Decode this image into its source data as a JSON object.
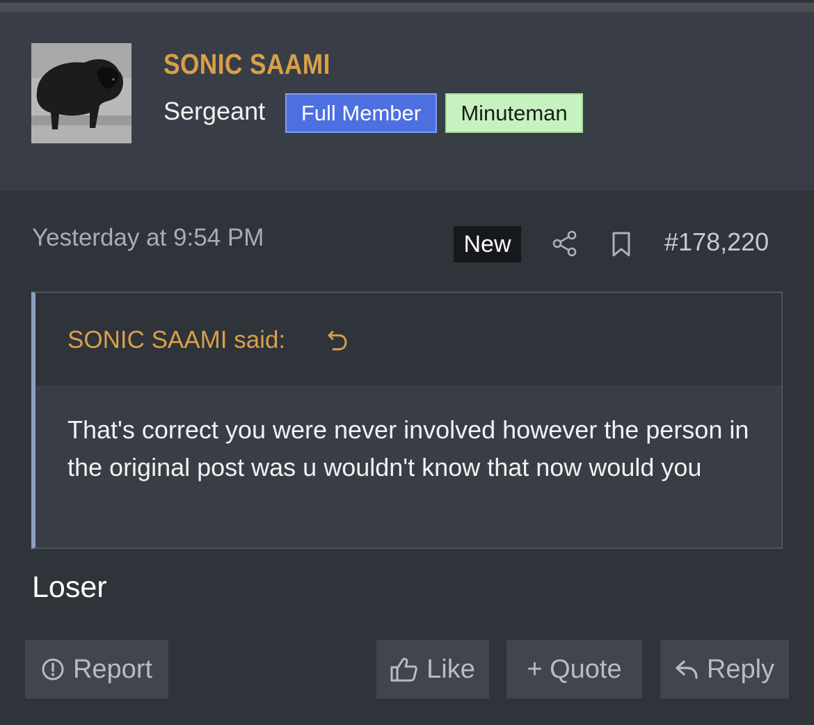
{
  "user": {
    "name": "SONIC SAAMI",
    "rank": "Sergeant",
    "badges": [
      {
        "label": "Full Member",
        "color": "#4d6fe0"
      },
      {
        "label": "Minuteman",
        "color": "#c7f2c0"
      }
    ],
    "avatar_icon": "bison-photo"
  },
  "post": {
    "timestamp": "Yesterday at 9:54 PM",
    "new_label": "New",
    "number": "#178,220",
    "body": "Loser"
  },
  "quote": {
    "attribution": "SONIC SAAMI said:",
    "text": "That's correct you were never involved however the person in the original post was u wouldn't know that now would you"
  },
  "actions": {
    "report": "Report",
    "like": "Like",
    "quote": "+ Quote",
    "reply": "Reply"
  },
  "colors": {
    "accent": "#d9a04a",
    "background": "#2f333a",
    "header": "#393e46"
  }
}
